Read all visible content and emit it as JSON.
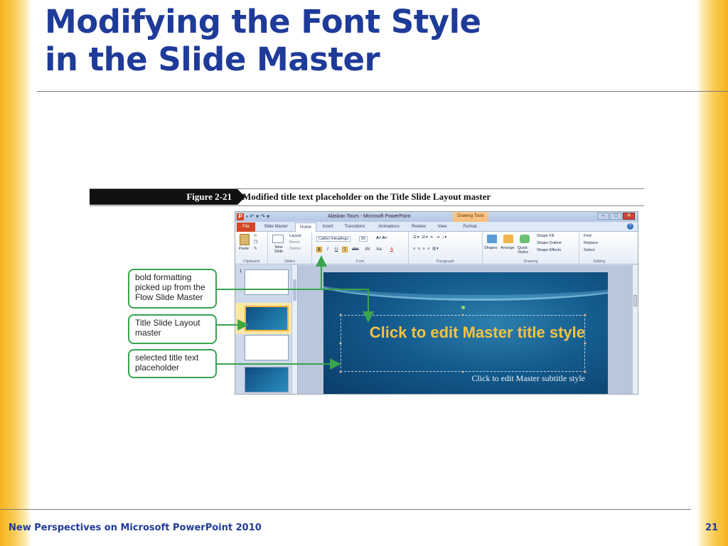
{
  "slide": {
    "title_line1": "Modifying the Font Style",
    "title_line2": "in the Slide Master"
  },
  "figure": {
    "label": "Figure 2-21",
    "caption": "Modified title text placeholder on the Title Slide Layout master"
  },
  "ppt": {
    "window_title": "Alaskan Tours - Microsoft PowerPoint",
    "contextual_tab": "Drawing Tools",
    "tabs": [
      "File",
      "Slide Master",
      "Home",
      "Insert",
      "Transitions",
      "Animations",
      "Review",
      "View",
      "Format"
    ],
    "active_tab": "Home",
    "ribbon": {
      "clipboard": {
        "label": "Clipboard",
        "paste": "Paste"
      },
      "slides": {
        "label": "Slides",
        "new_slide": "New Slide",
        "layout": "Layout",
        "reset": "Reset",
        "delete": "Delete"
      },
      "font": {
        "label": "Font",
        "font_name": "Calibri (Headings",
        "font_size": "56"
      },
      "paragraph": {
        "label": "Paragraph"
      },
      "drawing": {
        "label": "Drawing",
        "shapes": "Shapes",
        "arrange": "Arrange",
        "quick_styles": "Quick Styles",
        "shape_fill": "Shape Fill",
        "shape_outline": "Shape Outline",
        "shape_effects": "Shape Effects"
      },
      "editing": {
        "label": "Editing",
        "find": "Find",
        "replace": "Replace",
        "select": "Select"
      }
    },
    "thumbnail_number": "1",
    "master_title": "Click to edit Master title style",
    "master_subtitle": "Click to edit Master subtitle style"
  },
  "callouts": {
    "bold": "bold formatting picked up from the Flow Slide Master",
    "layout": "Title Slide Layout master",
    "placeholder": "selected title text placeholder"
  },
  "footer": {
    "course": "New Perspectives on Microsoft PowerPoint 2010",
    "page": "21"
  },
  "colors": {
    "title": "#1f3b99",
    "callout_border": "#3aa34f",
    "side_gradient": "#f6b21b",
    "title_placeholder_text": "#f5c242"
  }
}
